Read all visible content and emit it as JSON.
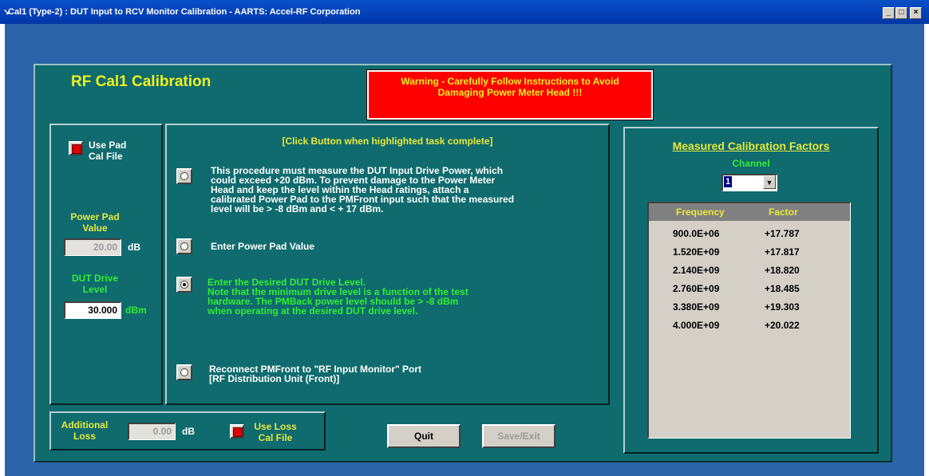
{
  "window": {
    "title": "Cal1 (Type-2) : DUT Input to RCV Monitor Calibration - AARTS: Accel-RF Corporation",
    "min_label": "_",
    "max_label": "□",
    "close_label": "×"
  },
  "header": {
    "title": "RF Cal1 Calibration",
    "warning_line1": "Warning - Carefully Follow Instructions to Avoid",
    "warning_line2": "Damaging Power Meter Head !!!"
  },
  "left_panel": {
    "use_pad_label_1": "Use Pad",
    "use_pad_label_2": "Cal File",
    "power_pad_label_1": "Power Pad",
    "power_pad_label_2": "Value",
    "power_pad_value": "20.00",
    "power_pad_unit": "dB",
    "dut_drive_label_1": "DUT Drive",
    "dut_drive_label_2": "Level",
    "dut_drive_value": "30.000",
    "dut_drive_unit": "dBm"
  },
  "bottom": {
    "additional_loss_label_1": "Additional",
    "additional_loss_label_2": "Loss",
    "additional_loss_value": "0.00",
    "additional_loss_unit": "dB",
    "use_loss_label_1": "Use Loss",
    "use_loss_label_2": "Cal File",
    "quit_label": "Quit",
    "save_exit_label": "Save/Exit"
  },
  "instructions": {
    "header": "[Click Button when highlighted task complete]",
    "steps": [
      {
        "lines": [
          "This procedure must measure the DUT Input Drive Power, which",
          "could exceed +20 dBm.  To prevent damage to the Power Meter",
          "Head and keep the level within the Head ratings, attach a",
          "calibrated Power Pad to the PMFront input such that the measured",
          "level will be > -8 dBm and < + 17 dBm."
        ]
      },
      {
        "lines": [
          "Enter Power Pad Value"
        ]
      },
      {
        "lines": [
          "Enter the Desired DUT Drive Level.",
          "Note that the minimum drive level is a function of the test",
          "hardware.  The PMBack power level should be > -8 dBm",
          "when operating at the desired DUT drive level."
        ]
      },
      {
        "lines": [
          "Reconnect PMFront to \"RF Input Monitor\" Port",
          "[RF Distribution Unit (Front)]"
        ]
      }
    ]
  },
  "calibration": {
    "title": "Measured Calibration Factors",
    "channel_label": "Channel",
    "channel_value": "1",
    "col_frequency": "Frequency",
    "col_factor": "Factor",
    "rows": [
      {
        "frequency": "900.0E+06",
        "factor": "+17.787"
      },
      {
        "frequency": "1.520E+09",
        "factor": "+17.817"
      },
      {
        "frequency": "2.140E+09",
        "factor": "+18.820"
      },
      {
        "frequency": "2.760E+09",
        "factor": "+18.485"
      },
      {
        "frequency": "3.380E+09",
        "factor": "+19.303"
      },
      {
        "frequency": "4.000E+09",
        "factor": "+20.022"
      }
    ]
  }
}
